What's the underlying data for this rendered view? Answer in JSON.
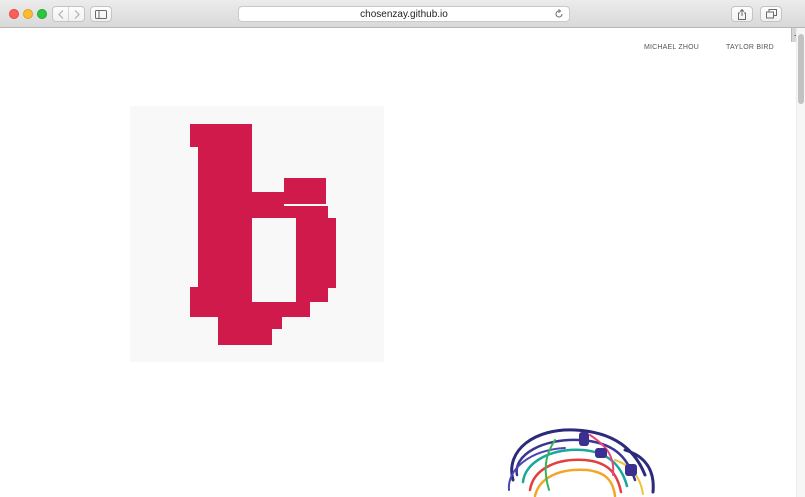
{
  "browser": {
    "url": "chosenzay.github.io",
    "icons": [
      "back-icon",
      "forward-icon",
      "sidebar-icon",
      "reload-icon",
      "share-icon",
      "tabs-icon",
      "plus-icon"
    ]
  },
  "nav": {
    "links": [
      "MICHAEL ZHOU",
      "TAYLOR BIRD"
    ]
  },
  "colors": {
    "accent": "#d01a4c",
    "link": "#555555",
    "card_bg": "#f8f8f8"
  }
}
